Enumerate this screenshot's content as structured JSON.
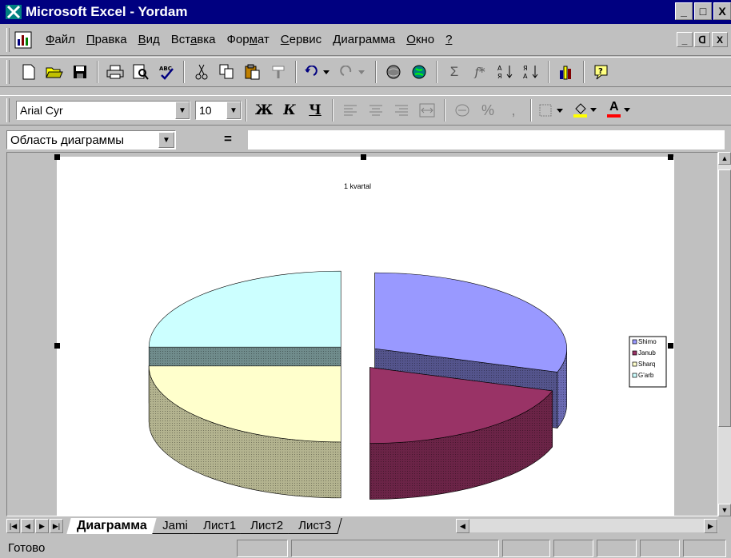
{
  "window": {
    "title": "Microsoft Excel - Yordam",
    "controls": [
      "_",
      "□",
      "X"
    ]
  },
  "menu": {
    "items": [
      {
        "label": "Файл",
        "accel": "Ф",
        "rest": "айл"
      },
      {
        "label": "Правка",
        "accel": "П",
        "rest": "равка"
      },
      {
        "label": "Вид",
        "accel": "В",
        "rest": "ид"
      },
      {
        "label": "Вставка",
        "pre": "Вст",
        "accel": "а",
        "rest": "вка"
      },
      {
        "label": "Формат",
        "pre": "Фор",
        "accel": "м",
        "rest": "ат"
      },
      {
        "label": "Сервис",
        "accel": "С",
        "rest": "ервис"
      },
      {
        "label": "Диаграмма",
        "accel": "Д",
        "rest": "иаграмма"
      },
      {
        "label": "Окно",
        "accel": "О",
        "rest": "кно"
      },
      {
        "label": "?",
        "accel": "?",
        "rest": ""
      }
    ],
    "doc_controls": [
      "_",
      "ᗡ",
      "X"
    ]
  },
  "toolbar_standard": {
    "buttons": [
      "new-icon",
      "open-icon",
      "save-icon",
      "print-icon",
      "print-preview-icon",
      "spelling-icon",
      "cut-icon",
      "copy-icon",
      "paste-icon",
      "format-painter-icon",
      "undo-icon",
      "redo-icon",
      "web-toolbar-icon",
      "hyperlink-icon",
      "autosum-icon",
      "function-icon",
      "sort-ascending-icon",
      "sort-descending-icon",
      "chart-wizard-icon",
      "office-assistant-icon"
    ],
    "sum_glyph": "Σ",
    "fx_glyph": "f*"
  },
  "toolbar_formatting": {
    "font_name": "Arial Cyr",
    "font_size": "10",
    "bold_label": "Ж",
    "italic_label": "К",
    "underline_label": "Ч",
    "percent_label": "%",
    "comma_label": ",",
    "font_color_label": "A",
    "colors": {
      "fill": "#ffff00",
      "font": "#ff0000"
    }
  },
  "formula_bar": {
    "name_box": "Область диаграммы",
    "equals": "=",
    "value": ""
  },
  "chart_data": {
    "type": "pie",
    "style": "3d-exploded",
    "title": "1 kvartal",
    "categories": [
      "Shimol",
      "Janub",
      "Sharq",
      "G'arb"
    ],
    "legend_labels": [
      "Shimo",
      "Janub",
      "Sharq",
      "G'arb"
    ],
    "values": [
      30,
      20,
      25,
      25
    ],
    "legend_position": "right",
    "colors": {
      "Shimol": "#9999ff",
      "Janub": "#993366",
      "Sharq": "#ffffcc",
      "G'arb": "#ccffff"
    }
  },
  "sheet_tabs": {
    "tabs": [
      "Диаграмма",
      "Jami",
      "Лист1",
      "Лист2",
      "Лист3"
    ],
    "active": "Диаграмма"
  },
  "status": {
    "text": "Готово"
  }
}
